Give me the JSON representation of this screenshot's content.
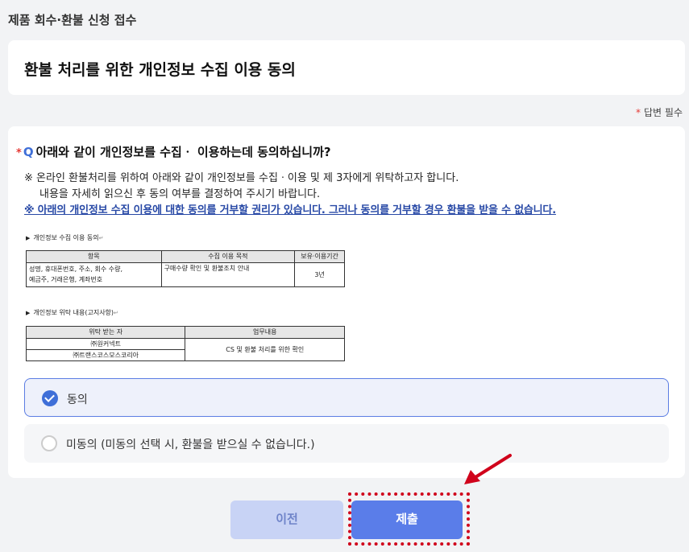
{
  "header": {
    "title": "제품 회수·환불 신청 접수"
  },
  "form": {
    "title": "환불 처리를 위한 개인정보 수집 이용 동의"
  },
  "required_note": {
    "star": "*",
    "text": "답변 필수"
  },
  "question": {
    "star": "*",
    "q_label": "Q",
    "text": "아래와 같이 개인정보를 수집ㆍ 이용하는데 동의하십니까?",
    "notice_line1": "※ 온라인 환불처리를 위하여 아래와 같이 개인정보를 수집ㆍ이용 및 제 3자에게 위탁하고자 합니다.",
    "notice_line2": "내용을 자세히 읽으신 후 동의 여부를 결정하여 주시기 바랍니다.",
    "notice_link": "※ 아래의 개인정보 수집 이용에 대한 동의를 거부할 권리가 있습니다. 그러나 동의를 거부할 경우 환불을 받을 수 없습니다."
  },
  "doc": {
    "section1": "개인정보 수집 이용 동의",
    "table1": {
      "headers": [
        "항목",
        "수집 이용 목적",
        "보유·이용기간"
      ],
      "items_line1": "성명, 휴대폰번호, 주소, 회수 수량,",
      "items_line2": "예금주, 거래은행, 계좌번호",
      "purpose": "구매수량 확인 및 환불조치 안내",
      "period": "3년"
    },
    "section2": "개인정보 위탁 내용(고지사항)",
    "table2": {
      "headers": [
        "위탁 받는 자",
        "업무내용"
      ],
      "company1": "㈜원커넥트",
      "company2": "㈜트랜스코스모스코리아",
      "task": "CS 및 환불 처리를 위한 확인"
    }
  },
  "options": [
    {
      "label": "동의",
      "selected": true
    },
    {
      "label": "미동의 (미동의 선택 시, 환불을 받으실 수 없습니다.)",
      "selected": false
    }
  ],
  "buttons": {
    "prev": "이전",
    "submit": "제출"
  },
  "colors": {
    "accent": "#3f6fd8",
    "required": "#e53935",
    "annotation": "#d0021b"
  }
}
